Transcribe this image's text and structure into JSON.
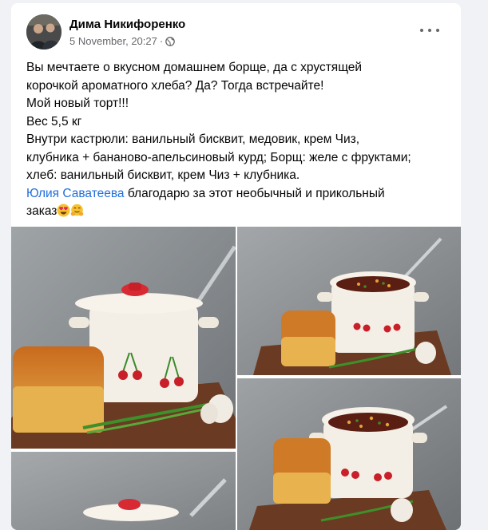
{
  "post": {
    "author": "Дима Никифоренко",
    "timestamp": "5 November, 20:27",
    "separator": "·",
    "lines": [
      "Вы мечтаете о вкусном домашнем борще, да с хрустящей",
      "корочкой ароматного хлеба? Да? Тогда встречайте!",
      "Мой новый торт!!!",
      "Вес 5,5 кг",
      "Внутри кастрюли: ванильный бисквит, медовик, крем Чиз,",
      "клубника + бананово-апельсиновый курд; Борщ: желе с фруктами;",
      "хлеб: ванильный бисквит, крем Чиз + клубника."
    ],
    "mention": "Юлия Саватеева",
    "mention_rest": " благодарю за этот необычный и прикольный",
    "last_line": "заказ",
    "emojis": [
      "heart-eyes-emoji",
      "hugging-face-emoji"
    ]
  },
  "icons": {
    "globe": "globe-icon",
    "more": "more-options-icon"
  },
  "colors": {
    "link": "#216fdb",
    "text": "#050505",
    "meta": "#65676b",
    "background": "#f0f2f5"
  }
}
